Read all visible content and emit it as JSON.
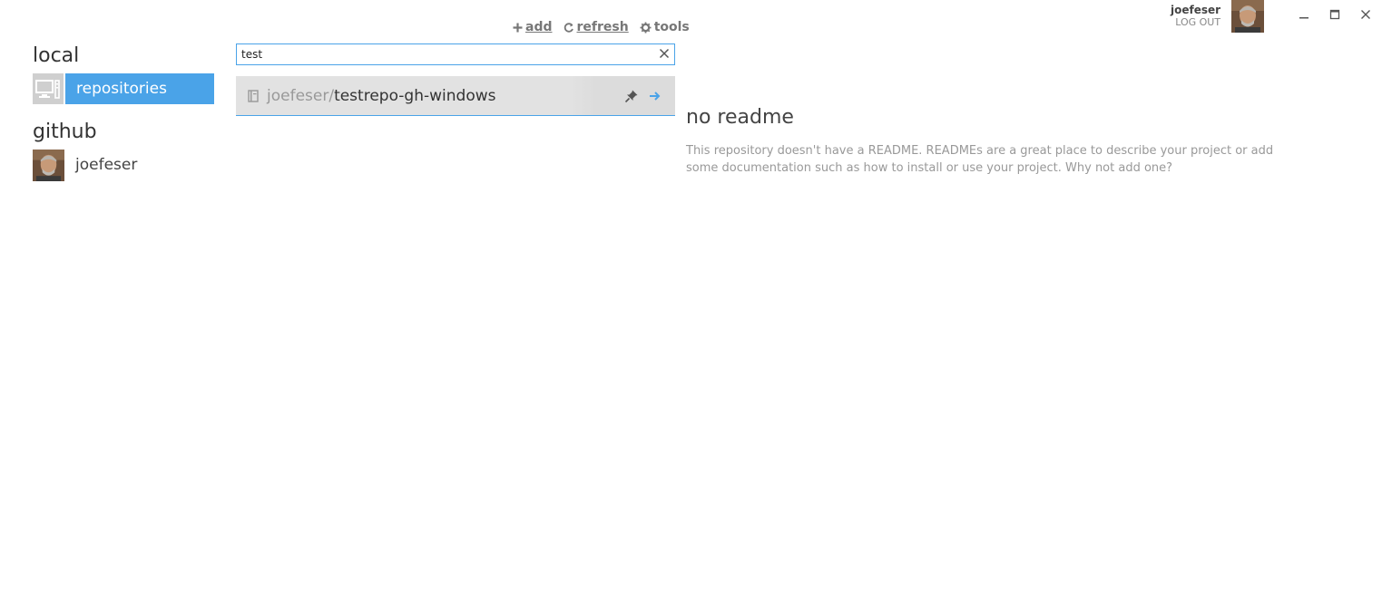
{
  "user": {
    "name": "joefeser",
    "logout_label": "LOG OUT"
  },
  "window_controls": {
    "minimize_icon": "minimize-icon",
    "maximize_icon": "maximize-icon",
    "close_icon": "close-icon"
  },
  "nav": {
    "local_heading": "local",
    "local_items": [
      {
        "label": "repositories",
        "icon": "computer-icon",
        "selected": true
      }
    ],
    "github_heading": "github",
    "github_items": [
      {
        "label": "joefeser",
        "icon": "avatar"
      }
    ]
  },
  "toolbar": {
    "add_label": "add",
    "refresh_label": "refresh",
    "tools_label": "tools"
  },
  "search": {
    "value": "test"
  },
  "repos": [
    {
      "owner": "joefeser/",
      "name": "testrepo-gh-windows"
    }
  ],
  "readme": {
    "title": "no readme",
    "body": "This repository doesn't have a README. READMEs are a great place to describe your project or add some documentation such as how to install or use your project. Why not add one?"
  },
  "colors": {
    "accent": "#4aa3e8",
    "row_bg": "#e2e2e2",
    "muted_text": "#999999"
  }
}
